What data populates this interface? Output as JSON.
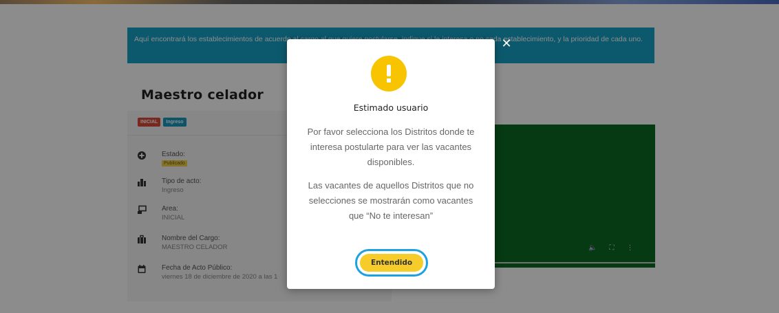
{
  "banner": {
    "text": "Aquí encontrará los establecimientos de acuerdo al cargo al que quiere postularse, indique si le interesa o no cada establecimiento, y la prioridad de cada uno."
  },
  "card": {
    "title": "Maestro celador",
    "badges": [
      "INICIAL",
      "Ingreso"
    ],
    "details": [
      {
        "icon": "plus-circle-icon",
        "label": "Estado:",
        "value": "Publicado"
      },
      {
        "icon": "building-icon",
        "label": "Tipo de acto:",
        "value": "Ingreso"
      },
      {
        "icon": "screen-icon",
        "label": "Area:",
        "value": "INICIAL"
      },
      {
        "icon": "briefcase-icon",
        "label": "Nombre del Cargo:",
        "value": "MAESTRO CELADOR"
      },
      {
        "icon": "calendar-icon",
        "label": "Fecha de Acto Público:",
        "value": "viernes 18 de diciembre de 2020 a las 1"
      }
    ]
  },
  "video": {
    "controls": [
      "volume-icon",
      "fullscreen-icon",
      "more-options-icon"
    ]
  },
  "modal": {
    "close": "✕",
    "title": "Estimado usuario",
    "text1": "Por favor selecciona los Distritos donde te interesa postularte para ver las vacantes disponibles.",
    "text2": "Las vacantes de aquellos Distritos que no selecciones se mostrarán como vacantes que “No te interesan”",
    "button": "Entendido"
  },
  "colors": {
    "banner": "#17a2c8",
    "accent": "#f6cc2a",
    "alert": "#f8c400",
    "highlight_ring": "#1fa0e0",
    "video": "#0c6a22"
  }
}
